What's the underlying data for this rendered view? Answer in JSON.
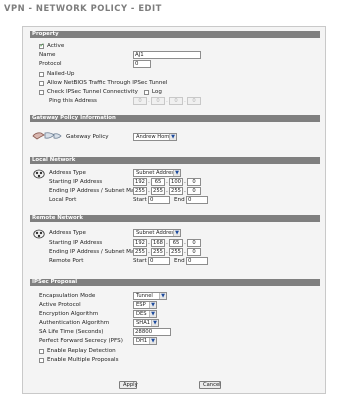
{
  "title": "VPN - NETWORK POLICY - EDIT",
  "property": {
    "header": "Property",
    "active_label": "Active",
    "active_checked": true,
    "name_label": "Name",
    "name_value": "AJ1",
    "protocol_label": "Protocol",
    "protocol_value": "0",
    "nailed_up_label": "Nailed-Up",
    "netbios_label": "Allow NetBIOS Traffic Through IPSec Tunnel",
    "check_conn_label": "Check IPSec Tunnel Connectivity",
    "log_label": "Log",
    "ping_label": "Ping this Address",
    "ping_octets": [
      "0",
      "0",
      "0",
      "0"
    ]
  },
  "gateway": {
    "header": "Gateway Policy Information",
    "label": "Gateway Policy",
    "value": "Andrew Home"
  },
  "local_network": {
    "header": "Local Network",
    "address_type_label": "Address Type",
    "address_type_value": "Subnet Address",
    "start_ip_label": "Starting IP Address",
    "start_ip": [
      "192",
      "65",
      "100",
      "0"
    ],
    "end_ip_label": "Ending IP Address / Subnet Mask",
    "end_ip": [
      "255",
      "255",
      "255",
      "0"
    ],
    "port_label": "Local Port",
    "start_label": "Start",
    "start_value": "0",
    "end_label": "End",
    "end_value": "0"
  },
  "remote_network": {
    "header": "Remote Network",
    "address_type_label": "Address Type",
    "address_type_value": "Subnet Address",
    "start_ip_label": "Starting IP Address",
    "start_ip": [
      "192",
      "168",
      "65",
      "0"
    ],
    "end_ip_label": "Ending IP Address / Subnet Mask",
    "end_ip": [
      "255",
      "255",
      "255",
      "0"
    ],
    "port_label": "Remote Port",
    "start_label": "Start",
    "start_value": "0",
    "end_label": "End",
    "end_value": "0"
  },
  "ipsec": {
    "header": "IPSec Proposal",
    "encap_label": "Encapsulation Mode",
    "encap_value": "Tunnel",
    "protocol_label": "Active Protocol",
    "protocol_value": "ESP",
    "enc_label": "Encryption Algorithm",
    "enc_value": "DES",
    "auth_label": "Authentication Algorithm",
    "auth_value": "SHA1",
    "sa_label": "SA Life Time (Seconds)",
    "sa_value": "28800",
    "pfs_label": "Perfect Forward Secrecy (PFS)",
    "pfs_value": "DH1",
    "replay_label": "Enable Replay Detection",
    "multi_label": "Enable Multiple Proposals"
  },
  "buttons": {
    "apply": "Apply",
    "cancel": "Cancel"
  },
  "colors": {
    "section_header": "#7f7f7f",
    "check_mark": "#2f8f2f",
    "select_arrow": "#1e4c9e"
  },
  "icons": {
    "gateway": "gateway-tunnel-icon",
    "local": "local-network-icon",
    "remote": "remote-network-icon"
  }
}
